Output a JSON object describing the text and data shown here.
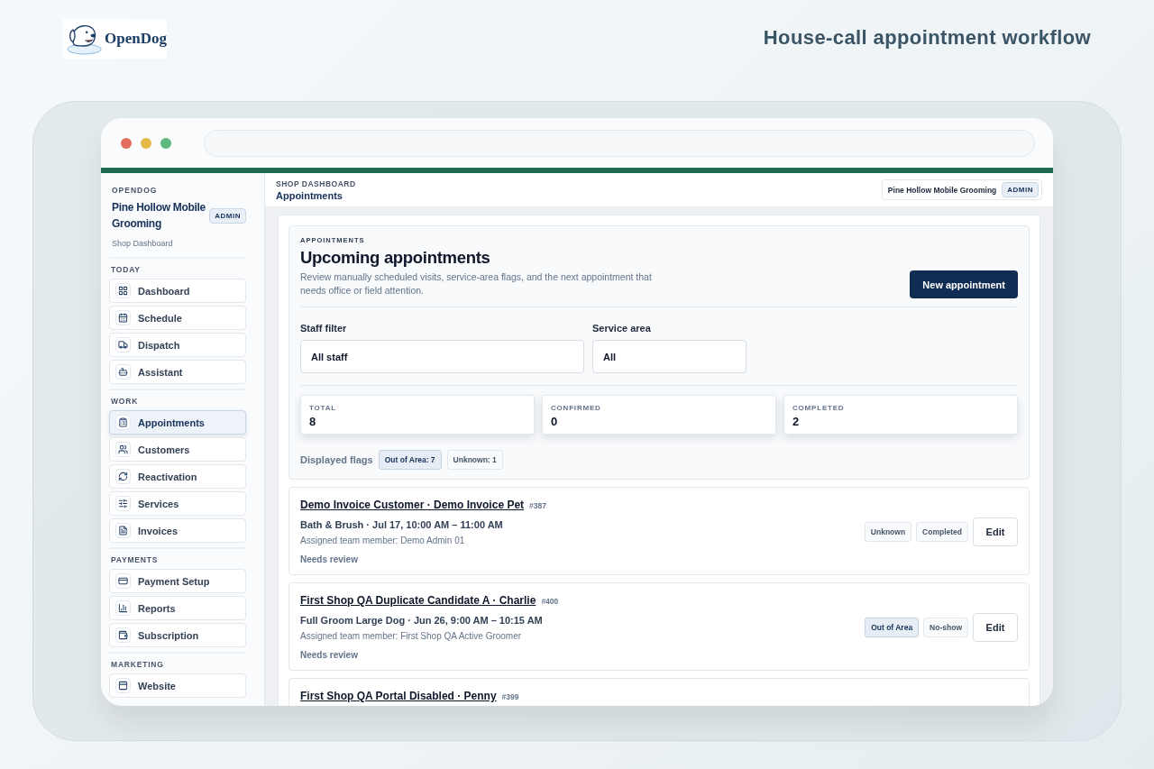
{
  "brand": {
    "logo_text": "OpenDog"
  },
  "headline": "House-call appointment workflow",
  "sidebar": {
    "eyebrow": "OPENDOG",
    "shop_name": "Pine Hollow Mobile Grooming",
    "role_badge": "ADMIN",
    "subtitle": "Shop Dashboard",
    "sections": [
      {
        "label": "TODAY",
        "items": [
          {
            "label": "Dashboard",
            "selected": false
          },
          {
            "label": "Schedule",
            "selected": false
          },
          {
            "label": "Dispatch",
            "selected": false
          },
          {
            "label": "Assistant",
            "selected": false
          }
        ]
      },
      {
        "label": "WORK",
        "items": [
          {
            "label": "Appointments",
            "selected": true
          },
          {
            "label": "Customers",
            "selected": false
          },
          {
            "label": "Reactivation",
            "selected": false
          },
          {
            "label": "Services",
            "selected": false
          },
          {
            "label": "Invoices",
            "selected": false
          }
        ]
      },
      {
        "label": "PAYMENTS",
        "items": [
          {
            "label": "Payment Setup",
            "selected": false
          },
          {
            "label": "Reports",
            "selected": false
          },
          {
            "label": "Subscription",
            "selected": false
          }
        ]
      },
      {
        "label": "MARKETING",
        "items": [
          {
            "label": "Website",
            "selected": false
          }
        ]
      }
    ]
  },
  "topbar": {
    "breadcrumb": "SHOP DASHBOARD",
    "page_title": "Appointments",
    "shop_name": "Pine Hollow Mobile Grooming",
    "role_badge": "ADMIN"
  },
  "panel": {
    "eyebrow": "APPOINTMENTS",
    "title": "Upcoming appointments",
    "description": "Review manually scheduled visits, service-area flags, and the next appointment that needs office or field attention.",
    "primary_button": "New appointment",
    "filters": [
      {
        "label": "Staff filter",
        "value": "All staff"
      },
      {
        "label": "Service area",
        "value": "All"
      }
    ],
    "stats": [
      {
        "label": "TOTAL",
        "value": "8"
      },
      {
        "label": "CONFIRMED",
        "value": "0"
      },
      {
        "label": "COMPLETED",
        "value": "2"
      }
    ],
    "flags_label": "Displayed flags",
    "flags": [
      {
        "label": "Out of Area: 7",
        "highlighted": true
      },
      {
        "label": "Unknown: 1",
        "highlighted": false
      }
    ]
  },
  "appointments": [
    {
      "title": "Demo Invoice Customer · Demo Invoice Pet",
      "number": "#387",
      "service": "Bath & Brush · Jul 17, 10:00 AM – 11:00 AM",
      "assignee": "Assigned team member: Demo Admin 01",
      "note": "Needs review",
      "tags": [
        {
          "label": "Unknown",
          "highlighted": false
        },
        {
          "label": "Completed",
          "highlighted": false
        }
      ],
      "action": "Edit"
    },
    {
      "title": "First Shop QA Duplicate Candidate A · Charlie",
      "number": "#400",
      "service": "Full Groom Large Dog · Jun 26, 9:00 AM – 10:15 AM",
      "assignee": "Assigned team member: First Shop QA Active Groomer",
      "note": "Needs review",
      "tags": [
        {
          "label": "Out of Area",
          "highlighted": true
        },
        {
          "label": "No-show",
          "highlighted": false
        }
      ],
      "action": "Edit"
    },
    {
      "title": "First Shop QA Portal Disabled · Penny",
      "number": "#399"
    }
  ]
}
